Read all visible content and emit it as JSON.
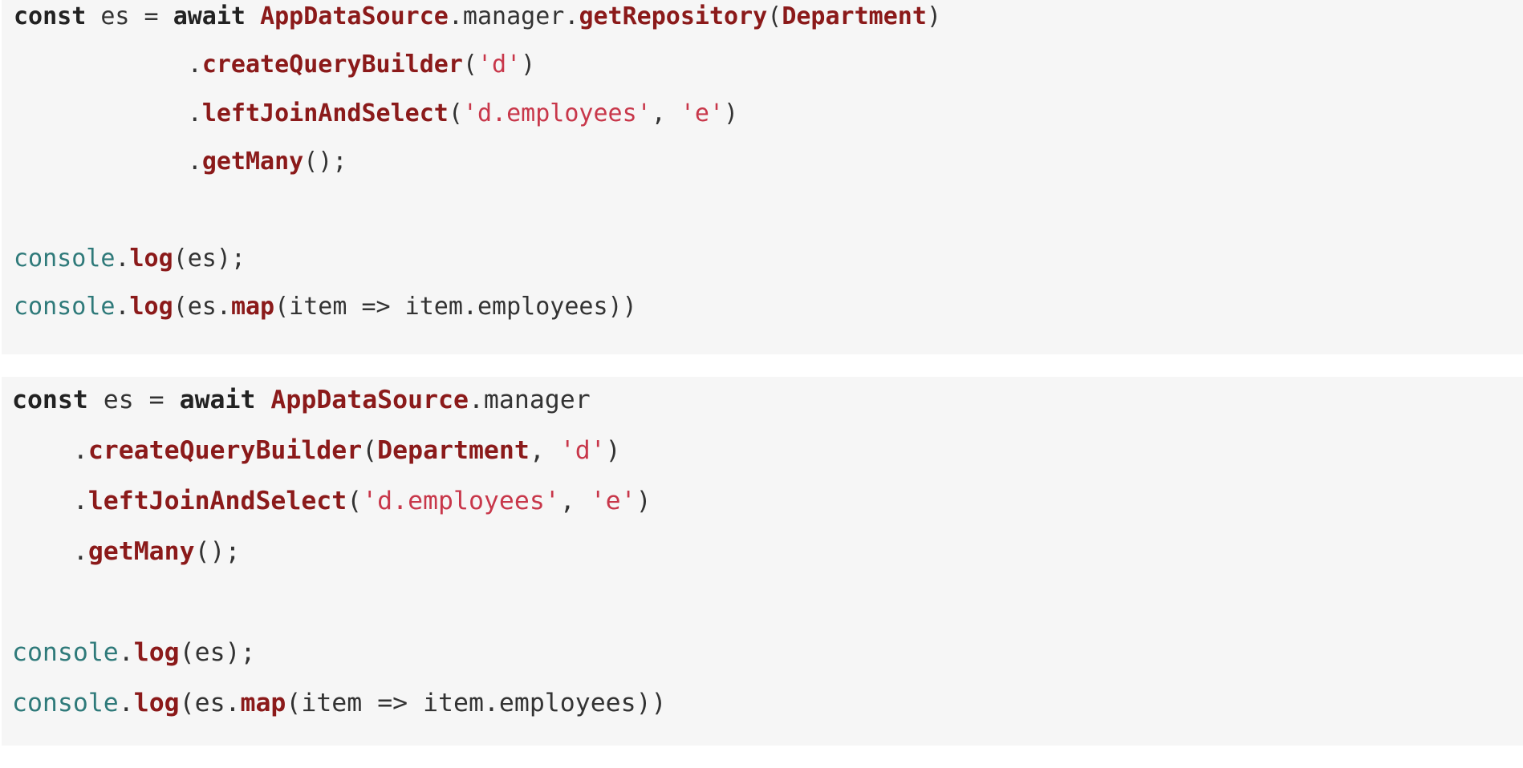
{
  "snippets": [
    {
      "lines": [
        [
          [
            "kw",
            "const"
          ],
          [
            "plain",
            " es = "
          ],
          [
            "kw",
            "await"
          ],
          [
            "plain",
            " "
          ],
          [
            "cls",
            "AppDataSource"
          ],
          [
            "plain",
            ".manager."
          ],
          [
            "fn",
            "getRepository"
          ],
          [
            "plain",
            "("
          ],
          [
            "cls",
            "Department"
          ],
          [
            "plain",
            ")"
          ]
        ],
        [
          [
            "plain",
            "            ."
          ],
          [
            "fn",
            "createQueryBuilder"
          ],
          [
            "plain",
            "("
          ],
          [
            "str",
            "'d'"
          ],
          [
            "plain",
            ")"
          ]
        ],
        [
          [
            "plain",
            "            ."
          ],
          [
            "fn",
            "leftJoinAndSelect"
          ],
          [
            "plain",
            "("
          ],
          [
            "str",
            "'d.employees'"
          ],
          [
            "plain",
            ", "
          ],
          [
            "str",
            "'e'"
          ],
          [
            "plain",
            ")"
          ]
        ],
        [
          [
            "plain",
            "            ."
          ],
          [
            "fn",
            "getMany"
          ],
          [
            "plain",
            "();"
          ]
        ],
        [],
        [
          [
            "glob",
            "console"
          ],
          [
            "plain",
            "."
          ],
          [
            "fn",
            "log"
          ],
          [
            "plain",
            "(es);"
          ]
        ],
        [
          [
            "glob",
            "console"
          ],
          [
            "plain",
            "."
          ],
          [
            "fn",
            "log"
          ],
          [
            "plain",
            "(es."
          ],
          [
            "fn",
            "map"
          ],
          [
            "plain",
            "(item => item.employees))"
          ]
        ]
      ]
    },
    {
      "lines": [
        [
          [
            "kw",
            "const"
          ],
          [
            "plain",
            " es = "
          ],
          [
            "kw",
            "await"
          ],
          [
            "plain",
            " "
          ],
          [
            "cls",
            "AppDataSource"
          ],
          [
            "plain",
            ".manager"
          ]
        ],
        [
          [
            "plain",
            "    ."
          ],
          [
            "fn",
            "createQueryBuilder"
          ],
          [
            "plain",
            "("
          ],
          [
            "cls",
            "Department"
          ],
          [
            "plain",
            ", "
          ],
          [
            "str",
            "'d'"
          ],
          [
            "plain",
            ")"
          ]
        ],
        [
          [
            "plain",
            "    ."
          ],
          [
            "fn",
            "leftJoinAndSelect"
          ],
          [
            "plain",
            "("
          ],
          [
            "str",
            "'d.employees'"
          ],
          [
            "plain",
            ", "
          ],
          [
            "str",
            "'e'"
          ],
          [
            "plain",
            ")"
          ]
        ],
        [
          [
            "plain",
            "    ."
          ],
          [
            "fn",
            "getMany"
          ],
          [
            "plain",
            "();"
          ]
        ],
        [],
        [
          [
            "glob",
            "console"
          ],
          [
            "plain",
            "."
          ],
          [
            "fn",
            "log"
          ],
          [
            "plain",
            "(es);"
          ]
        ],
        [
          [
            "glob",
            "console"
          ],
          [
            "plain",
            "."
          ],
          [
            "fn",
            "log"
          ],
          [
            "plain",
            "(es."
          ],
          [
            "fn",
            "map"
          ],
          [
            "plain",
            "(item => item.employees))"
          ]
        ]
      ]
    }
  ]
}
